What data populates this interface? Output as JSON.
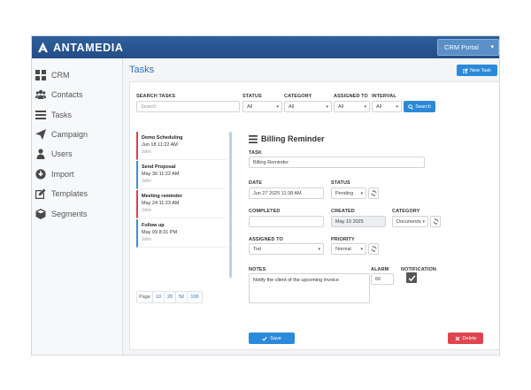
{
  "header": {
    "app_name": "ANTAMEDIA",
    "portal_select": "CRM Portal"
  },
  "sidebar": {
    "items": [
      {
        "label": "CRM",
        "icon": "grid-icon"
      },
      {
        "label": "Contacts",
        "icon": "users-icon"
      },
      {
        "label": "Tasks",
        "icon": "list-icon"
      },
      {
        "label": "Campaign",
        "icon": "paper-plane-icon"
      },
      {
        "label": "Users",
        "icon": "user-icon"
      },
      {
        "label": "Import",
        "icon": "import-icon"
      },
      {
        "label": "Templates",
        "icon": "edit-icon"
      },
      {
        "label": "Segments",
        "icon": "cube-icon"
      }
    ]
  },
  "page": {
    "title": "Tasks",
    "new_task_label": "New Task"
  },
  "filters": {
    "search_label": "SEARCH TASKS",
    "search_placeholder": "Search",
    "status_label": "STATUS",
    "status_value": "All",
    "category_label": "CATEGORY",
    "category_value": "All",
    "assigned_label": "ASSIGNED TO",
    "assigned_value": "All",
    "interval_label": "INTERVAL",
    "interval_value": "All",
    "search_button": "Search"
  },
  "task_list": [
    {
      "title": "Demo Scheduling",
      "date": "Jun 18 11:22 AM",
      "user": "John",
      "color": "#e04040"
    },
    {
      "title": "Send Proposal",
      "date": "May 30 11:22 AM",
      "user": "John",
      "color": "#3a8fd9"
    },
    {
      "title": "Meeting reminder",
      "date": "May 24 11:23 AM",
      "user": "John",
      "color": "#e04040"
    },
    {
      "title": "Follow up",
      "date": "May 09 8:31 PM",
      "user": "John",
      "color": "#3a8fd9"
    }
  ],
  "pager": {
    "label": "Page",
    "sizes": [
      "10",
      "20",
      "50",
      "100"
    ]
  },
  "detail": {
    "title": "Billing Reminder",
    "task_label": "TASK",
    "task_value": "Billing Reminder",
    "date_label": "DATE",
    "date_value": "Jun 27 2025 11:38 AM",
    "status_label": "STATUS",
    "status_value": "Pending",
    "completed_label": "COMPLETED",
    "completed_value": "",
    "created_label": "CREATED",
    "created_value": "May 10 2025",
    "category_label": "CATEGORY",
    "category_value": "Documents",
    "assigned_label": "ASSIGNED TO",
    "assigned_value": "Tod",
    "priority_label": "PRIORITY",
    "priority_value": "Normal",
    "notes_label": "NOTES",
    "notes_value": "Notify the client of the upcoming invoice",
    "alarm_label": "ALARM",
    "alarm_value": "60",
    "notification_label": "NOTIFICATION",
    "save_button": "Save",
    "delete_button": "Delete"
  },
  "colors": {
    "header": "#2a5690",
    "accent": "#2b8ad8",
    "danger": "#e0454f"
  }
}
